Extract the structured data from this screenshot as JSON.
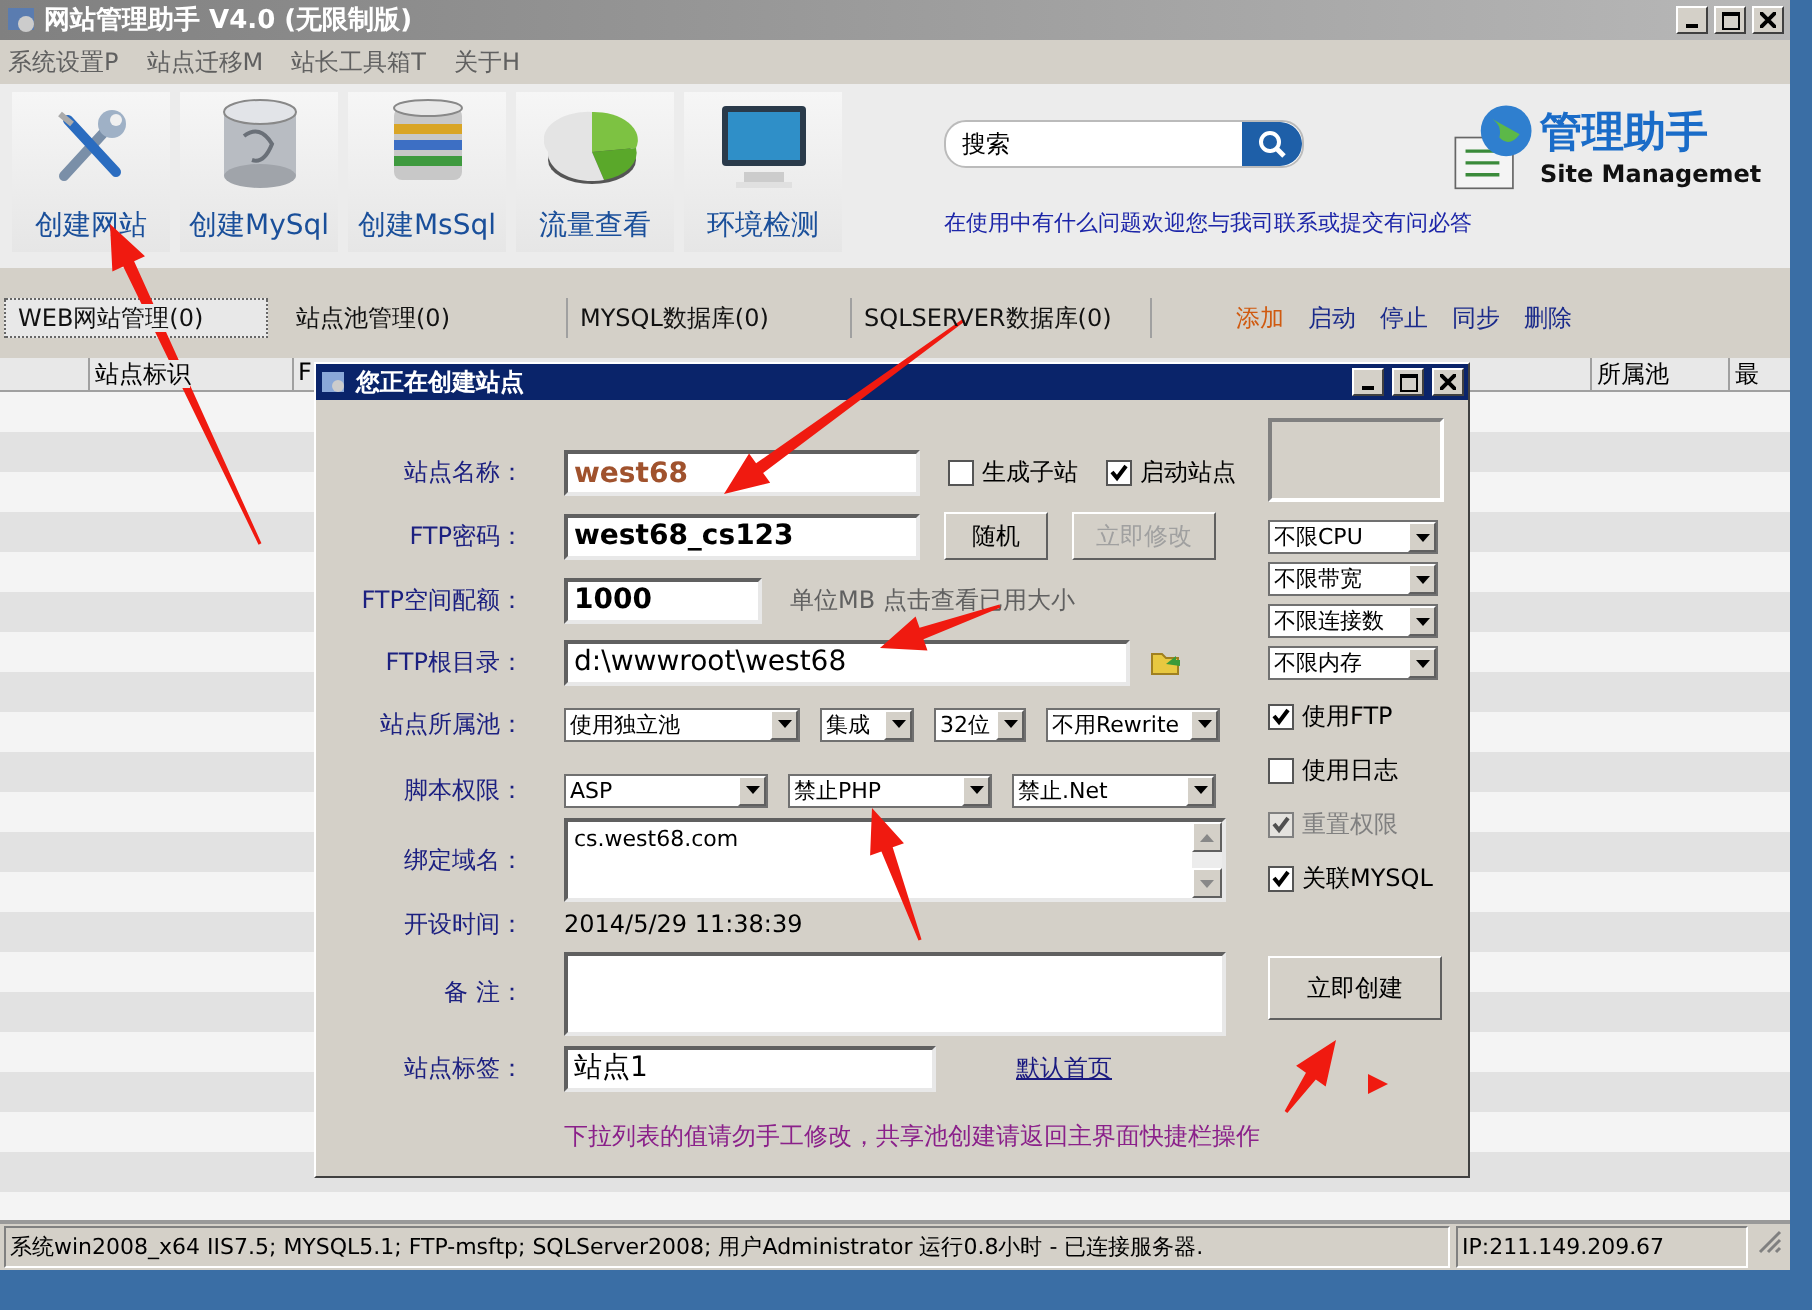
{
  "window": {
    "title": "网站管理助手 V4.0 (无限制版)"
  },
  "menu": [
    "系统设置P",
    "站点迁移M",
    "站长工具箱T",
    "关于H"
  ],
  "toolbar": [
    {
      "label": "创建网站"
    },
    {
      "label": "创建MySql"
    },
    {
      "label": "创建MsSql"
    },
    {
      "label": "流量查看"
    },
    {
      "label": "环境检测"
    }
  ],
  "search": {
    "placeholder": "搜索"
  },
  "help_text": "在使用中有什么问题欢迎您与我司联系或提交有问必答",
  "logo": {
    "title": "管理助手",
    "subtitle": "Site Managemet"
  },
  "tabs": [
    {
      "label": "WEB网站管理(0)",
      "selected": true
    },
    {
      "label": "站点池管理(0)",
      "selected": false
    },
    {
      "label": "MYSQL数据库(0)",
      "selected": false
    },
    {
      "label": "SQLSERVER数据库(0)",
      "selected": false
    }
  ],
  "actions": [
    {
      "label": "添加",
      "highlighted": true
    },
    {
      "label": "启动",
      "highlighted": false
    },
    {
      "label": "停止",
      "highlighted": false
    },
    {
      "label": "同步",
      "highlighted": false
    },
    {
      "label": "删除",
      "highlighted": false
    }
  ],
  "table": {
    "columns": [
      {
        "label": "站点标识"
      },
      {
        "label": "F"
      },
      {
        "label": "所属池"
      },
      {
        "label": "最"
      }
    ]
  },
  "status_bar": {
    "info": "系统win2008_x64 IIS7.5; MYSQL5.1; FTP-msftp; SQLServer2008; 用户Administrator 运行0.8小时 - 已连接服务器.",
    "ip": "IP:211.149.209.67"
  },
  "dialog": {
    "title": "您正在创建站点",
    "site_name": {
      "label": "站点名称：",
      "value": "west68"
    },
    "options": [
      {
        "label": "生成子站",
        "checked": false
      },
      {
        "label": "启动站点",
        "checked": true
      }
    ],
    "ftp_password": {
      "label": "FTP密码：",
      "value": "west68_cs123"
    },
    "password_buttons": [
      {
        "label": "随机",
        "disabled": false
      },
      {
        "label": "立即修改",
        "disabled": true
      }
    ],
    "ftp_quota": {
      "label": "FTP空间配额：",
      "value": "1000",
      "hint": "单位MB 点击查看已用大小"
    },
    "ftp_root": {
      "label": "FTP根目录：",
      "value": "d:\\wwwroot\\west68"
    },
    "pool": {
      "label": "站点所属池：",
      "selects": [
        "使用独立池",
        "集成",
        "32位",
        "不用Rewrite"
      ]
    },
    "script": {
      "label": "脚本权限：",
      "selects": [
        "ASP",
        "禁止PHP",
        "禁止.Net"
      ]
    },
    "domains": {
      "label": "绑定域名：",
      "value": "cs.west68.com"
    },
    "created": {
      "label": "开设时间：",
      "value": "2014/5/29 11:38:39"
    },
    "remark": {
      "label": "备 注："
    },
    "tag": {
      "label": "站点标签：",
      "value": "站点1"
    },
    "default_page_link": "默认首页",
    "note": "下拉列表的值请勿手工修改，共享池创建请返回主界面快捷栏操作",
    "limits": [
      "不限CPU",
      "不限带宽",
      "不限连接数",
      "不限内存"
    ],
    "switches": [
      {
        "label": "使用FTP",
        "checked": true,
        "disabled": false
      },
      {
        "label": "使用日志",
        "checked": false,
        "disabled": false
      },
      {
        "label": "重置权限",
        "checked": true,
        "disabled": true
      },
      {
        "label": "关联MYSQL",
        "checked": true,
        "disabled": false
      }
    ],
    "create_button": "立即创建"
  }
}
